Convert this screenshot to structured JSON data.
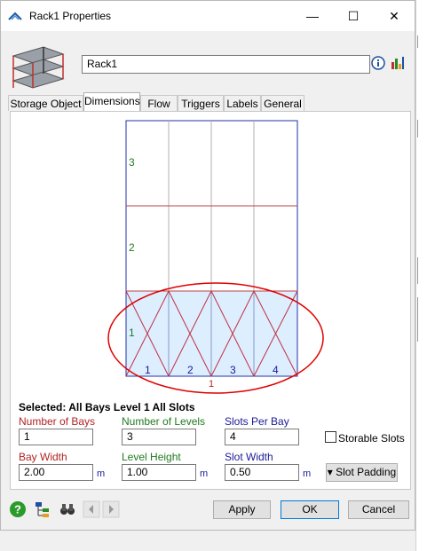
{
  "window": {
    "title": "Rack1  Properties",
    "minimize": "—",
    "maximize": "☐",
    "close": "✕"
  },
  "header": {
    "name_value": "Rack1"
  },
  "tabs": [
    {
      "label": "Storage Object"
    },
    {
      "label": "Dimensions"
    },
    {
      "label": "Flow"
    },
    {
      "label": "Triggers"
    },
    {
      "label": "Labels"
    },
    {
      "label": "General"
    }
  ],
  "diagram": {
    "level_labels": [
      "3",
      "2",
      "1"
    ],
    "bay_labels": [
      "1",
      "2",
      "3",
      "4"
    ],
    "selected_level_marker": "1"
  },
  "selection": {
    "title": "Selected: All Bays Level 1 All Slots"
  },
  "fields": {
    "number_of_bays": {
      "label": "Number of Bays",
      "value": "1"
    },
    "number_of_levels": {
      "label": "Number of Levels",
      "value": "3"
    },
    "slots_per_bay": {
      "label": "Slots Per Bay",
      "value": "4"
    },
    "bay_width": {
      "label": "Bay Width",
      "value": "2.00",
      "unit": "m"
    },
    "level_height": {
      "label": "Level Height",
      "value": "1.00",
      "unit": "m"
    },
    "slot_width": {
      "label": "Slot Width",
      "value": "0.50",
      "unit": "m"
    }
  },
  "storable_slots": {
    "label": "Storable Slots",
    "checked": false
  },
  "slot_padding": {
    "label": "▾ Slot Padding"
  },
  "footer": {
    "apply": "Apply",
    "ok": "OK",
    "cancel": "Cancel"
  }
}
